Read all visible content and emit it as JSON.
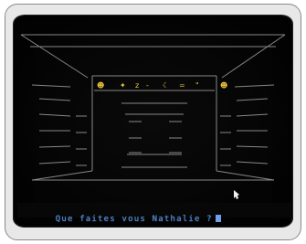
{
  "game": {
    "prompt_text": "Que faites vous Nathalie ?",
    "input_value": ""
  },
  "scene": {
    "view": "corridor-with-doorway",
    "palette": {
      "background": "#050505",
      "lines": "#9a9a9a",
      "prompt": "#5d8fd6",
      "glyphs": "#e8c43a"
    },
    "doorway_glyphs": [
      {
        "name": "face-glyph",
        "symbol": "☻"
      },
      {
        "name": "sparkle-glyph",
        "symbol": "✦"
      },
      {
        "name": "z-glyph",
        "symbol": "z"
      },
      {
        "name": "dash-glyph",
        "symbol": "-"
      },
      {
        "name": "moon-glyph",
        "symbol": "☾"
      },
      {
        "name": "equals-glyph",
        "symbol": "="
      },
      {
        "name": "quote-glyph",
        "symbol": "\""
      },
      {
        "name": "face-glyph-2",
        "symbol": "☻"
      }
    ]
  }
}
